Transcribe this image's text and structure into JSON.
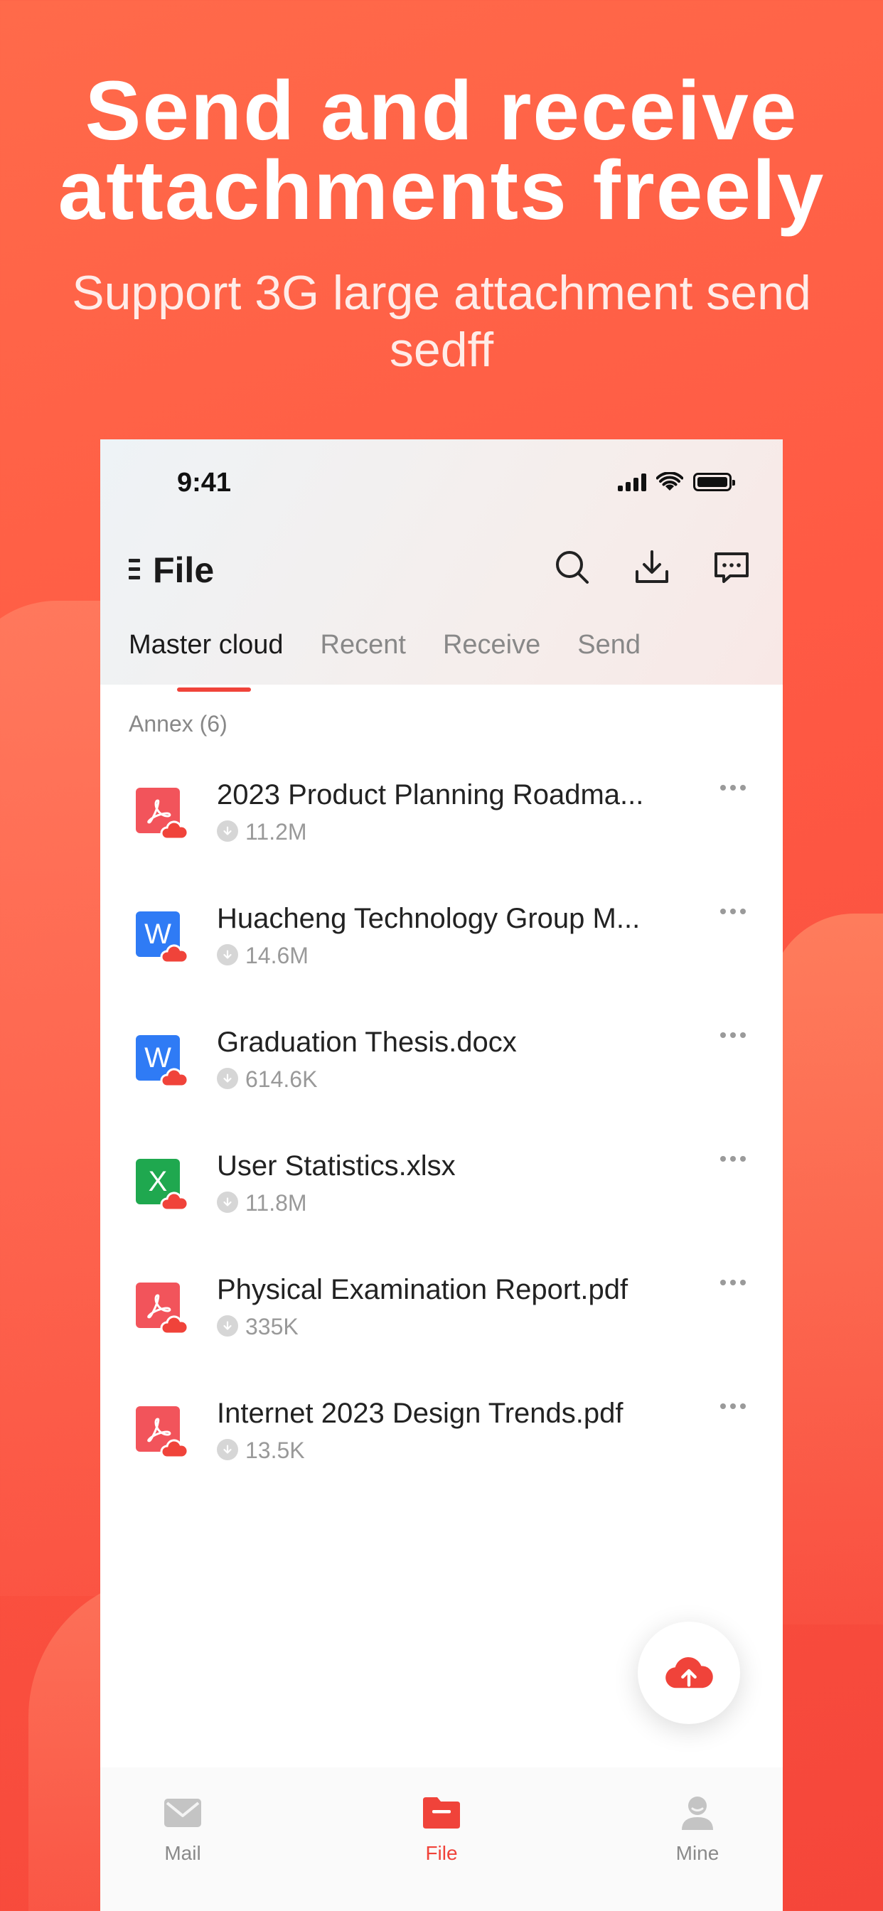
{
  "promo": {
    "headline_line1": "Send and receive",
    "headline_line2": "attachments freely",
    "subtitle": "Support 3G large attachment send sedff"
  },
  "status_bar": {
    "time": "9:41"
  },
  "header": {
    "title": "File",
    "icons": [
      "search-icon",
      "download-icon",
      "message-icon"
    ]
  },
  "tabs": [
    {
      "label": "Master cloud",
      "active": true
    },
    {
      "label": "Recent",
      "active": false
    },
    {
      "label": "Receive",
      "active": false
    },
    {
      "label": "Send",
      "active": false
    }
  ],
  "annex_label": "Annex (6)",
  "files": [
    {
      "name": "2023 Product Planning Roadma...",
      "size": "11.2M",
      "type": "pdf"
    },
    {
      "name": "Huacheng Technology Group M...",
      "size": "14.6M",
      "type": "word"
    },
    {
      "name": "Graduation Thesis.docx",
      "size": "614.6K",
      "type": "word"
    },
    {
      "name": "User Statistics.xlsx",
      "size": "11.8M",
      "type": "excel"
    },
    {
      "name": "Physical Examination Report.pdf",
      "size": "335K",
      "type": "pdf"
    },
    {
      "name": "Internet 2023 Design Trends.pdf",
      "size": "13.5K",
      "type": "pdf"
    }
  ],
  "file_type_glyphs": {
    "word": "W",
    "excel": "X"
  },
  "colors": {
    "accent": "#f0433a",
    "pdf": "#f2545b",
    "word": "#2f7bf5",
    "excel": "#1fa84f"
  },
  "tabbar": [
    {
      "label": "Mail",
      "active": false
    },
    {
      "label": "File",
      "active": true
    },
    {
      "label": "Mine",
      "active": false
    }
  ]
}
